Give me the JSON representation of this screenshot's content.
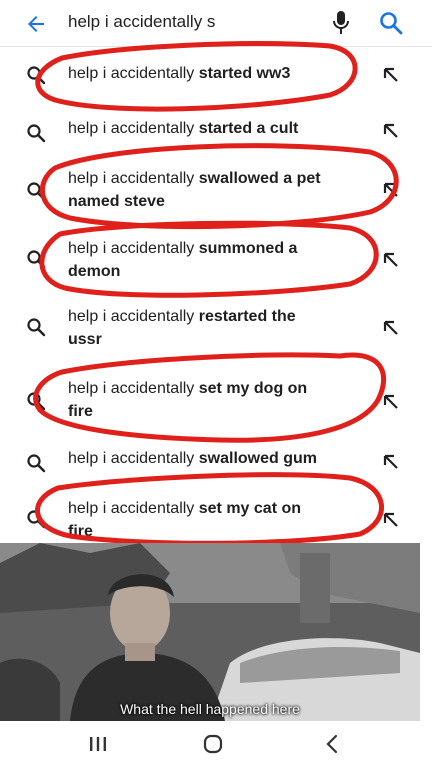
{
  "search": {
    "query": "help  i accidentally s"
  },
  "suggestions": [
    {
      "prefix": "help i accidentally ",
      "bold": "started ww3",
      "line2": ""
    },
    {
      "prefix": "help i accidentally ",
      "bold": "started a cult",
      "line2": ""
    },
    {
      "prefix": "help i accidentally ",
      "bold": "swallowed a pet",
      "line2": "named steve"
    },
    {
      "prefix": "help i accidentally ",
      "bold": "summoned a",
      "line2": "demon"
    },
    {
      "prefix": "help i accidentally ",
      "bold": "restarted the",
      "line2": "ussr"
    },
    {
      "prefix": "help i accidentally ",
      "bold": "set my dog on",
      "line2": "fire"
    },
    {
      "prefix": "help i accidentally ",
      "bold": "swallowed gum",
      "line2": ""
    },
    {
      "prefix": "help i accidentally ",
      "bold": "set my cat on",
      "line2": "fire"
    }
  ],
  "meme": {
    "caption": "What the hell happened here"
  },
  "colors": {
    "accent": "#1a73e8",
    "scribble": "#e0201b"
  }
}
